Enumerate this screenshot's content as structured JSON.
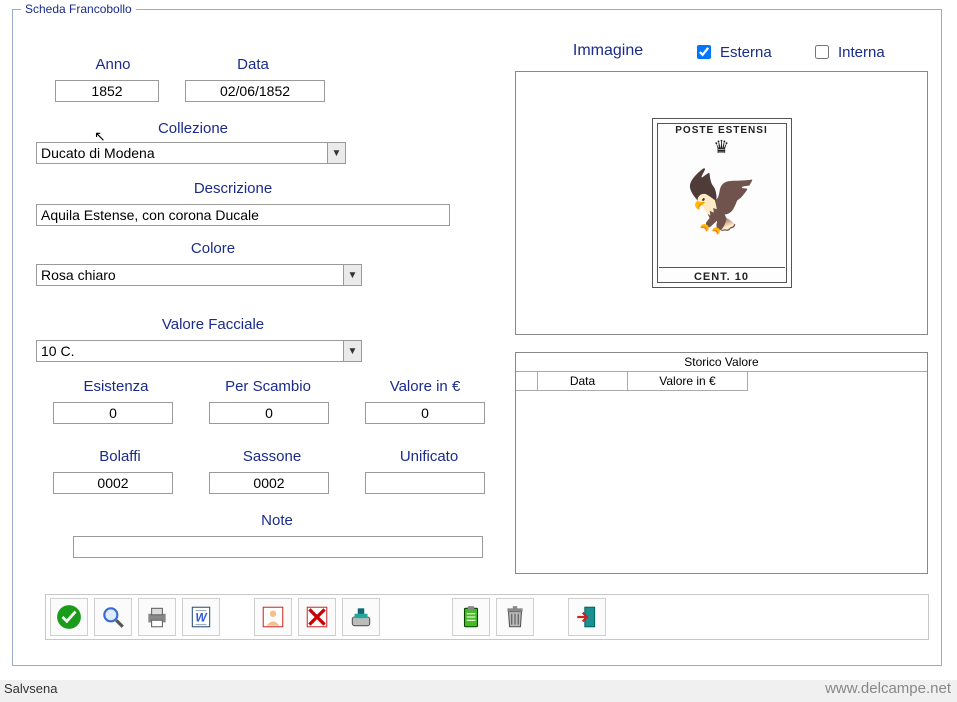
{
  "frame_title": "Scheda Francobollo",
  "labels": {
    "anno": "Anno",
    "data": "Data",
    "collezione": "Collezione",
    "descrizione": "Descrizione",
    "colore": "Colore",
    "valore_facciale": "Valore Facciale",
    "esistenza": "Esistenza",
    "per_scambio": "Per Scambio",
    "valore_eur": "Valore in €",
    "bolaffi": "Bolaffi",
    "sassone": "Sassone",
    "unificato": "Unificato",
    "note": "Note",
    "immagine": "Immagine",
    "esterna": "Esterna",
    "interna": "Interna"
  },
  "values": {
    "anno": "1852",
    "data": "02/06/1852",
    "collezione": "Ducato di Modena",
    "descrizione": "Aquila Estense, con corona Ducale",
    "colore": "Rosa chiaro",
    "valore_facciale": "10 C.",
    "esistenza": "0",
    "per_scambio": "0",
    "valore_eur": "0",
    "bolaffi": "0002",
    "sassone": "0002",
    "unificato": "",
    "note": ""
  },
  "image_radio": {
    "esterna": true,
    "interna": false
  },
  "stamp": {
    "top": "POSTE ESTENSI",
    "bottom": "CENT. 10"
  },
  "history": {
    "title": "Storico Valore",
    "col_blank": "",
    "col_data": "Data",
    "col_val": "Valore in €"
  },
  "toolbar": {
    "ok": "ok-icon",
    "search": "magnifier-icon",
    "print": "printer-icon",
    "word": "word-doc-icon",
    "person": "person-photo-icon",
    "delete_img": "delete-image-icon",
    "scanner": "scanner-icon",
    "clipboard": "clipboard-icon",
    "trash": "trash-icon",
    "exit": "exit-door-icon"
  },
  "status": "Salvsena",
  "watermark": "www.delcampe.net"
}
